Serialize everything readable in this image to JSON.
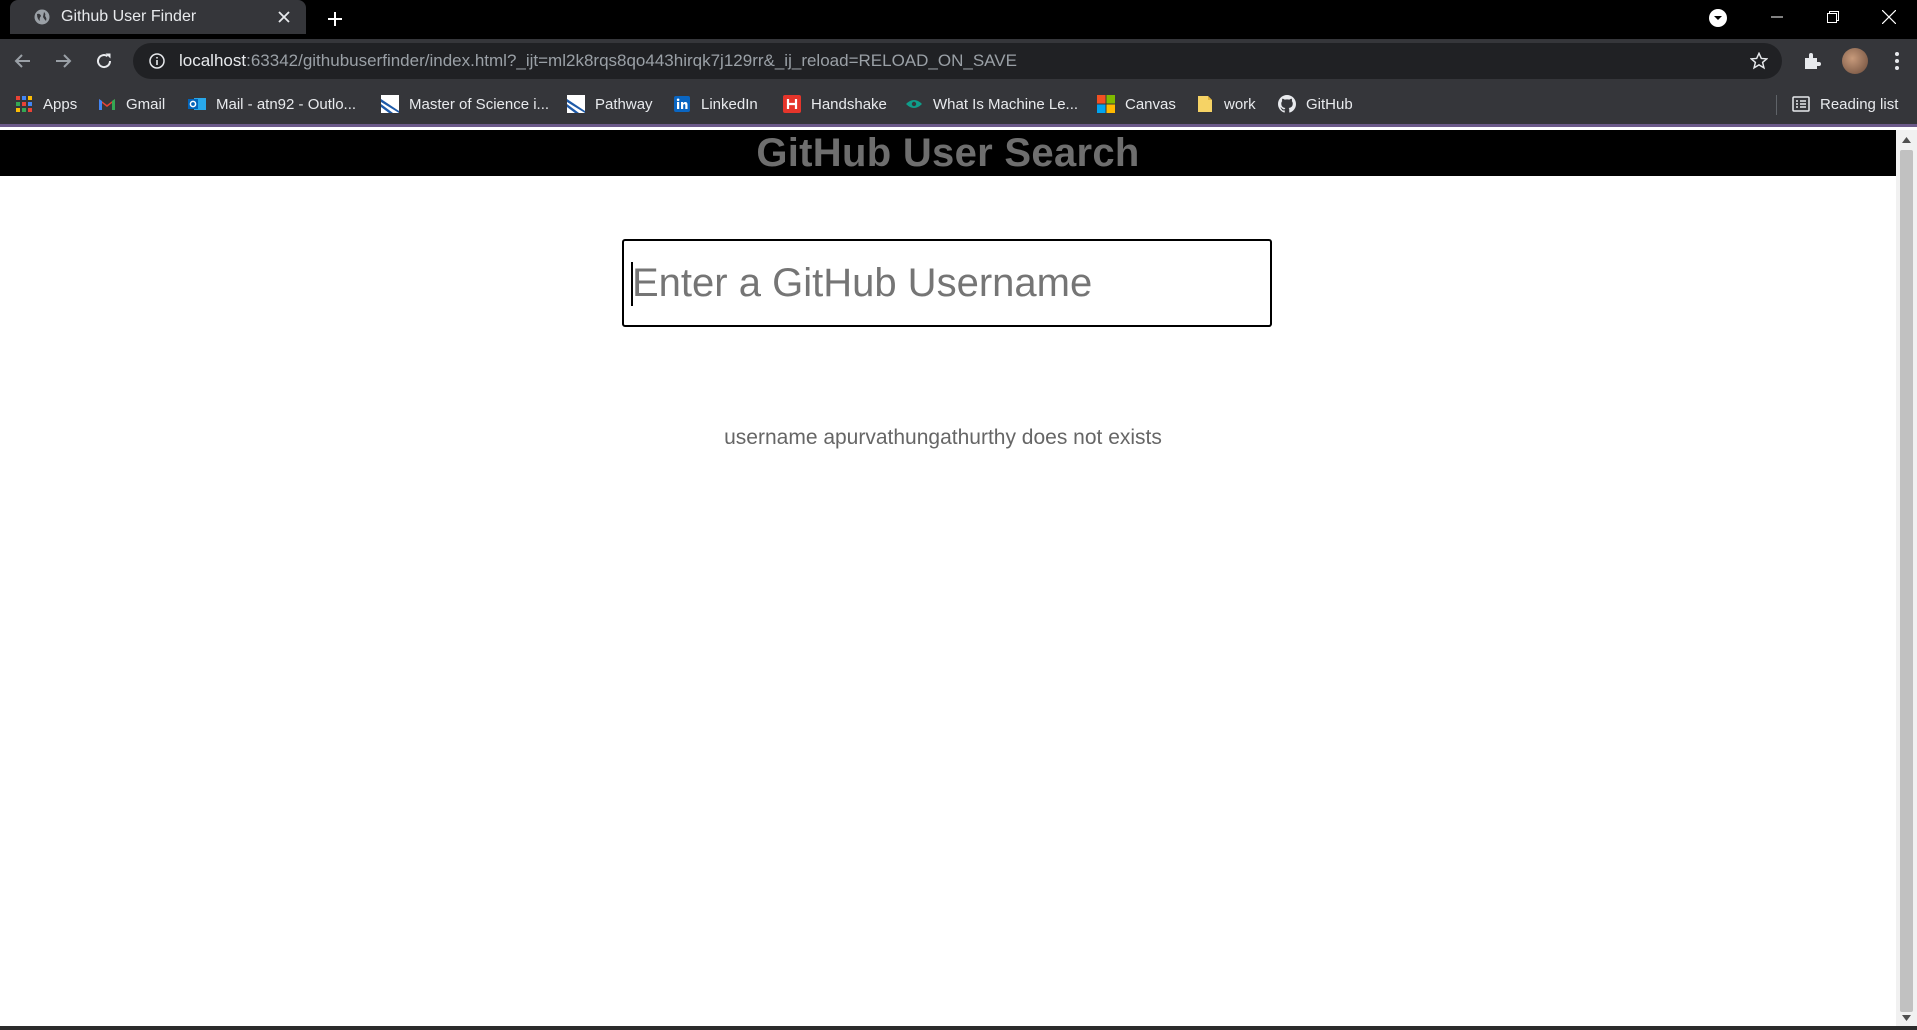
{
  "browser": {
    "tab_title": "Github User Finder",
    "url_host": "localhost",
    "url_rest": ":63342/githubuserfinder/index.html?_ijt=ml2k8rqs8qo443hirqk7j129rr&_ij_reload=RELOAD_ON_SAVE",
    "bookmarks": [
      {
        "label": "Apps",
        "icon": "apps-grid-icon"
      },
      {
        "label": "Gmail",
        "icon": "gmail-icon"
      },
      {
        "label": "Mail - atn92 - Outlo...",
        "icon": "outlook-icon"
      },
      {
        "label": "Master of Science i...",
        "icon": "bookmark-site-icon"
      },
      {
        "label": "Pathway",
        "icon": "bookmark-site-icon"
      },
      {
        "label": "LinkedIn",
        "icon": "linkedin-icon"
      },
      {
        "label": "Handshake",
        "icon": "handshake-icon"
      },
      {
        "label": "What Is Machine Le...",
        "icon": "bookmark-site-icon"
      },
      {
        "label": "Canvas",
        "icon": "microsoft-icon"
      },
      {
        "label": "work",
        "icon": "folder-icon"
      },
      {
        "label": "GitHub",
        "icon": "github-icon"
      }
    ],
    "reading_list": "Reading list"
  },
  "page": {
    "header_title": "GitHub User Search",
    "search_placeholder": "Enter a GitHub Username",
    "status_message": "username apurvathungathurthy does not exists"
  }
}
